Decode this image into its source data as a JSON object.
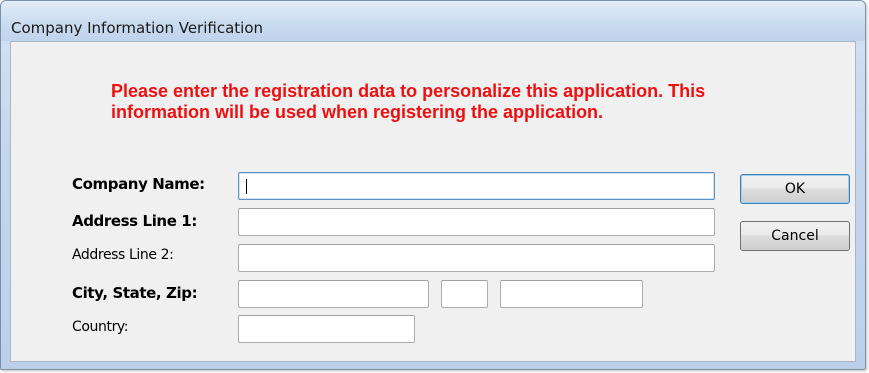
{
  "window": {
    "title": "Company Information Verification"
  },
  "instructions": "Please enter the registration data to personalize this application. This information will be used when registering the application.",
  "form": {
    "company_name": {
      "label": "Company Name:",
      "value": ""
    },
    "address_line_1": {
      "label": "Address Line 1:",
      "value": ""
    },
    "address_line_2": {
      "label": "Address Line 2:",
      "value": ""
    },
    "city_state_zip": {
      "label": "City, State, Zip:",
      "city": "",
      "state": "",
      "zip": ""
    },
    "country": {
      "label": "Country:",
      "value": ""
    }
  },
  "buttons": {
    "ok": "OK",
    "cancel": "Cancel"
  },
  "colors": {
    "instructions_text": "#ee1111",
    "dialog_background": "#f0f0f0",
    "frame": "#c5d7ee"
  }
}
